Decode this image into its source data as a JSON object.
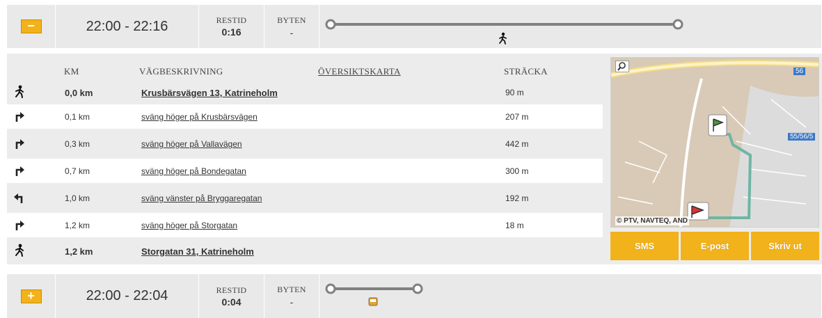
{
  "trips": [
    {
      "toggle": "−",
      "time": "22:00 - 22:16",
      "restid_label": "RESTID",
      "restid": "0:16",
      "byten_label": "BYTEN",
      "byten": "-",
      "timeline_mode": "walk-icon"
    },
    {
      "toggle": "+",
      "time": "22:00 - 22:04",
      "restid_label": "RESTID",
      "restid": "0:04",
      "byten_label": "BYTEN",
      "byten": "-",
      "timeline_mode": "bus-icon"
    }
  ],
  "directions": {
    "headers": {
      "km": "KM",
      "desc": "VÄGBESKRIVNING",
      "map": "ÖVERSIKTSKARTA",
      "dist": "STRÄCKA"
    },
    "rows": [
      {
        "icon": "walk-icon",
        "km": "0,0 km",
        "desc": "Krusbärsvägen 13, Katrineholm",
        "dist": "90 m"
      },
      {
        "icon": "turn-right-icon",
        "km": "0,1 km",
        "desc": "sväng höger på Krusbärsvägen",
        "dist": "207 m"
      },
      {
        "icon": "turn-right-icon",
        "km": "0,3 km",
        "desc": "sväng höger på Vallavägen",
        "dist": "442 m"
      },
      {
        "icon": "turn-right-icon",
        "km": "0,7 km",
        "desc": "sväng höger på Bondegatan",
        "dist": "300 m"
      },
      {
        "icon": "turn-left-icon",
        "km": "1,0 km",
        "desc": "sväng vänster på Bryggaregatan",
        "dist": "192 m"
      },
      {
        "icon": "turn-right-icon",
        "km": "1,2 km",
        "desc": "sväng höger på Storgatan",
        "dist": "18 m"
      },
      {
        "icon": "walk-icon",
        "km": "1,2 km",
        "desc": "Storgatan 31, Katrineholm",
        "dist": ""
      }
    ]
  },
  "map": {
    "copyright": "© PTV, NAVTEQ, AND",
    "road_label_1": "56",
    "road_label_2": "55/56/5",
    "route_color": "#6fb5a5"
  },
  "actions": {
    "sms": "SMS",
    "email": "E-post",
    "print": "Skriv ut"
  },
  "colors": {
    "accent": "#f2b21b",
    "header_bg": "#e9e9e9",
    "panel_bg": "#ececec"
  }
}
